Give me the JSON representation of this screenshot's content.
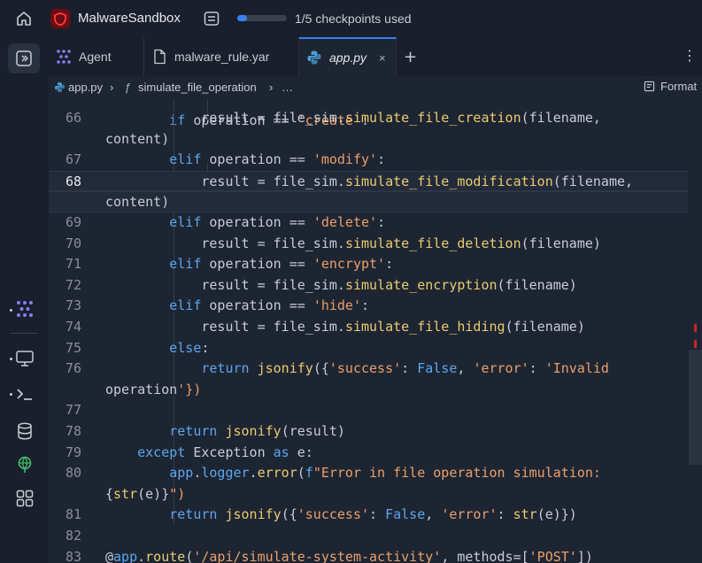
{
  "app": {
    "name": "MalwareSandbox"
  },
  "checkpoints": {
    "label": "1/5 checkpoints used",
    "used": 1,
    "total": 5
  },
  "tabs": [
    {
      "label": "Agent",
      "icon": "agent-icon"
    },
    {
      "label": "malware_rule.yar",
      "icon": "file-icon"
    },
    {
      "label": "app.py",
      "icon": "python-icon",
      "close": "×"
    }
  ],
  "tab_actions": {
    "add": "+",
    "more": "⋮"
  },
  "breadcrumb": {
    "file": "app.py",
    "func_symbol": "ƒ",
    "func": "simulate_file_operation",
    "ellipsis": "…"
  },
  "toolbar": {
    "format": "Format"
  },
  "editor": {
    "current_line": "68",
    "lines": [
      {
        "n": "66",
        "code": "            result = file_sim.simulate_file_creation(filename,"
      },
      {
        "n": "",
        "code": "content)"
      },
      {
        "n": "67",
        "code": "        elif operation == 'modify':"
      },
      {
        "n": "68",
        "code": "            result = file_sim.simulate_file_modification(filename,"
      },
      {
        "n": "",
        "code": "content)"
      },
      {
        "n": "69",
        "code": "        elif operation == 'delete':"
      },
      {
        "n": "70",
        "code": "            result = file_sim.simulate_file_deletion(filename)"
      },
      {
        "n": "71",
        "code": "        elif operation == 'encrypt':"
      },
      {
        "n": "72",
        "code": "            result = file_sim.simulate_encryption(filename)"
      },
      {
        "n": "73",
        "code": "        elif operation == 'hide':"
      },
      {
        "n": "74",
        "code": "            result = file_sim.simulate_file_hiding(filename)"
      },
      {
        "n": "75",
        "code": "        else:"
      },
      {
        "n": "76",
        "code": "            return jsonify({'success': False, 'error': 'Invalid"
      },
      {
        "n": "",
        "code": "operation'})"
      },
      {
        "n": "77",
        "code": ""
      },
      {
        "n": "78",
        "code": "        return jsonify(result)"
      },
      {
        "n": "79",
        "code": "    except Exception as e:"
      },
      {
        "n": "80",
        "code": "        app.logger.error(f\"Error in file operation simulation:"
      },
      {
        "n": "",
        "code": "{str(e)}\")"
      },
      {
        "n": "81",
        "code": "        return jsonify({'success': False, 'error': str(e)})"
      },
      {
        "n": "82",
        "code": ""
      },
      {
        "n": "83",
        "code": "@app.route('/api/simulate-system-activity', methods=['POST'])"
      }
    ]
  },
  "colors": {
    "accent": "#3b82f6",
    "keyword": "#5aa7f0",
    "string": "#e9a06b",
    "function": "#e8cc70",
    "brand": "#c9252b"
  }
}
